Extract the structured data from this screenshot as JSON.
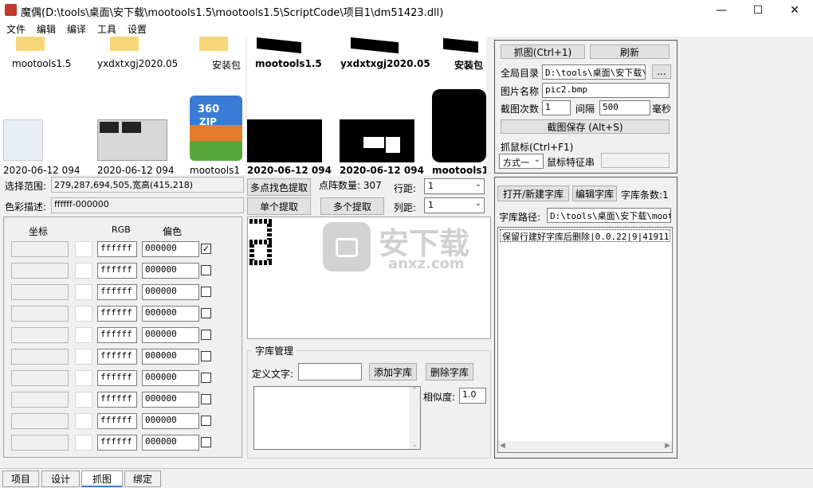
{
  "window": {
    "title": "魔偶(D:\\tools\\桌面\\安下载\\mootools1.5\\mootools1.5\\ScriptCode\\项目1\\dm51423.dll)"
  },
  "menu": [
    "文件",
    "编辑",
    "编译",
    "工具",
    "设置"
  ],
  "thumbs_left": {
    "row1": [
      "mootools1.5",
      "yxdxtxgj2020.05",
      "安装包"
    ],
    "row2": [
      "2020-06-12 094",
      "2020-06-12 094",
      "mootools1"
    ]
  },
  "thumbs_right": {
    "row1": [
      "mootools1.5",
      "yxdxtxgj2020.05",
      "安装包"
    ],
    "row2": [
      "2020-06-12 094",
      "2020-06-12 094",
      "mootools1"
    ]
  },
  "selection": {
    "range_label": "选择范围:",
    "range_value": "279,287,694,505,宽高(415,218)",
    "color_label": "色彩描述:",
    "color_value": "ffffff-000000"
  },
  "grid": {
    "header_coord": "坐标",
    "header_rgb": "RGB",
    "header_offset": "偏色",
    "rows": [
      {
        "rgb": "ffffff",
        "offset": "000000",
        "checked": "✓"
      },
      {
        "rgb": "ffffff",
        "offset": "000000",
        "checked": ""
      },
      {
        "rgb": "ffffff",
        "offset": "000000",
        "checked": ""
      },
      {
        "rgb": "ffffff",
        "offset": "000000",
        "checked": ""
      },
      {
        "rgb": "ffffff",
        "offset": "000000",
        "checked": ""
      },
      {
        "rgb": "ffffff",
        "offset": "000000",
        "checked": ""
      },
      {
        "rgb": "ffffff",
        "offset": "000000",
        "checked": ""
      },
      {
        "rgb": "ffffff",
        "offset": "000000",
        "checked": ""
      },
      {
        "rgb": "ffffff",
        "offset": "000000",
        "checked": ""
      },
      {
        "rgb": "ffffff",
        "offset": "000000",
        "checked": ""
      }
    ]
  },
  "extract": {
    "multi_color_btn": "多点找色提取",
    "dot_count_label": "点阵数量: 307",
    "row_gap_label": "行距:",
    "row_gap_value": "1",
    "single_btn": "单个提取",
    "multi_btn": "多个提取",
    "col_gap_label": "列距:",
    "col_gap_value": "1"
  },
  "library": {
    "group_title": "字库管理",
    "define_label": "定义文字:",
    "define_value": "",
    "add_btn": "添加字库",
    "delete_btn": "删除字库",
    "similarity_label": "相似度:",
    "similarity_value": "1.0"
  },
  "capture": {
    "capture_btn": "抓图(Ctrl+1)",
    "refresh_btn": "刷新",
    "dir_label": "全局目录",
    "dir_value": "D:\\tools\\桌面\\安下载\\",
    "dir_browse": "...",
    "name_label": "图片名称",
    "name_value": "pic2.bmp",
    "count_label": "截图次数",
    "count_value": "1",
    "interval_label": "间隔",
    "interval_value": "500",
    "ms_label": "毫秒",
    "save_btn": "截图保存 (Alt+S)",
    "mouse_label": "抓鼠标(Ctrl+F1)",
    "mode_value": "方式一",
    "feature_label": "鼠标特征串",
    "feature_value": ""
  },
  "dict": {
    "open_btn": "打开/新建字库",
    "edit_btn": "编辑字库",
    "remain_label": "字库条数:1",
    "path_label": "字库路径:",
    "path_value": "D:\\tools\\桌面\\安下载\\moot",
    "entry": "保留行建好字库后删除|0.0.22|9|41911"
  },
  "watermark": {
    "cn": "安下载",
    "en": "anxz.com"
  },
  "tabs": [
    "项目",
    "设计",
    "抓图",
    "绑定"
  ],
  "active_tab": "抓图"
}
